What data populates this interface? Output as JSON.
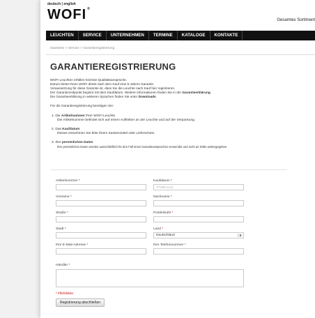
{
  "header": {
    "language": "deutsch | english",
    "logo": "WOFI",
    "logo_mark": "®",
    "right_text": "Gesamtes Sortiment"
  },
  "nav": {
    "items": [
      "LEUCHTEN",
      "SERVICE",
      "UNTERNEHMEN",
      "TERMINE",
      "KATALOGE",
      "KONTAKTE"
    ]
  },
  "breadcrumb": "Startseite > Service > Garantieregistrierung",
  "page_title": "GARANTIEREGISTRIERUNG",
  "intro": {
    "line1": "WOFI Leuchten erfüllen höchste Qualitätsansprüche.",
    "line2": "Darum bietet Ihnen WOFI direkt nach dem Kauf eine 5-Jahres Garantie.",
    "line3": "Voraussetzung für diese Garantie ist, dass Sie die Leuchte nach Kauf hier registrieren.",
    "line4_a": "Der Garantiezeitpunkt beginnt mit dem Kaufdatum. Weitere Informationen finden Sie in der ",
    "line4_b": "Garantieerklärung",
    "line5_a": "Die Garantieerklärung in weiteren Sprachen finden Sie unter ",
    "line5_b": "Downloads",
    "needs": "Für die Garantieregistrierung benötigen Sie:"
  },
  "steps": [
    {
      "num": "1.",
      "pre": "Die ",
      "title": "Artikelnummer",
      "post": " Ihrer WOFI Leuchte",
      "desc": "Die Artikelnummer befindet sich auf einem Aufkleber an der Leuchte und auf der Verpackung."
    },
    {
      "num": "2.",
      "pre": "Das ",
      "title": "Kaufdatum",
      "post": "",
      "desc": "Dieses entnehmen Sie bitte Ihrem Kassenzettel oder Lieferschein."
    },
    {
      "num": "3.",
      "pre": "Ihre ",
      "title": "persönlichen Daten",
      "post": "",
      "desc": "Ihre persönlichen Daten werden ausschließlich für den Fall eines Garantieanspruches verwendet und nicht an Dritte weitergegeben."
    }
  ],
  "form": {
    "artikel_label": "Artikelnummer",
    "kaufdatum_label": "Kaufdatum",
    "kaufdatum_placeholder": "TT.MM.JJJJ",
    "vorname_label": "Vorname",
    "nachname_label": "Nachname",
    "strasse_label": "Straße",
    "plz_label": "Postleitzahl",
    "stadt_label": "Stadt",
    "land_label": "Land",
    "land_value": "Deutschland",
    "email_label": "Ihre E-Mail-Adresse",
    "telefon_label": "Ihre Telefonnummer",
    "haendler_label": "Händler",
    "required_mark": "*",
    "required_note": "* Pflichtfelder",
    "submit_label": "Registrierung abschließen"
  }
}
